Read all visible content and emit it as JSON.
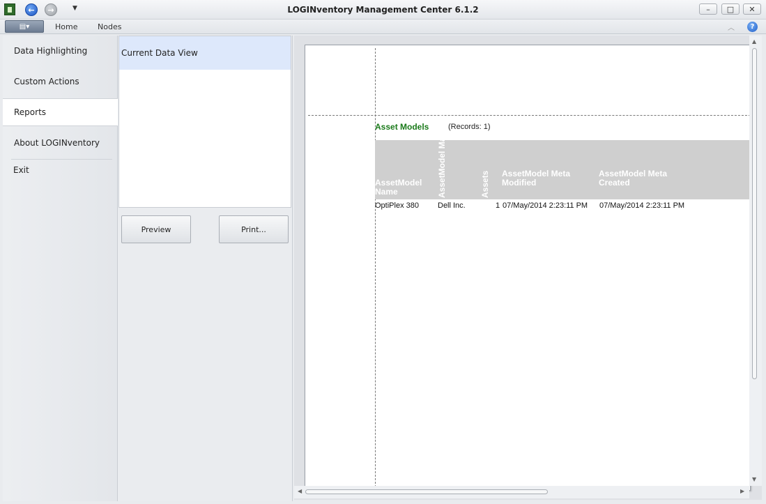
{
  "window": {
    "title": "LOGINventory Management Center 6.1.2",
    "minimize_glyph": "–",
    "maximize_glyph": "□",
    "close_glyph": "✕"
  },
  "quick_access": {
    "back_glyph": "←",
    "forward_glyph": "→",
    "dropdown_glyph": "▼"
  },
  "ribbon": {
    "app_menu_glyph": "▤▾",
    "tabs": [
      "Home",
      "Nodes"
    ],
    "collapse_glyph": "︿",
    "help_glyph": "?"
  },
  "nav": {
    "items": [
      "Data Highlighting",
      "Custom Actions",
      "Reports",
      "About LOGINventory"
    ],
    "active": "Reports",
    "exit_label": "Exit"
  },
  "reports": {
    "items": [
      "Current Data View"
    ],
    "preview_button": "Preview",
    "print_button": "Print..."
  },
  "report": {
    "title": "Asset Models",
    "records": "(Records: 1)",
    "columns": {
      "name": "AssetModel Name",
      "manufacturer": "AssetModel Manufacturer",
      "assets": "Assets",
      "modified": "AssetModel Meta Modified",
      "created": "AssetModel Meta Created"
    },
    "rows": [
      {
        "name": "OptiPlex 380",
        "manufacturer": "Dell Inc.",
        "assets": "1",
        "modified": "07/May/2014 2:23:11 PM",
        "created": "07/May/2014 2:23:11 PM"
      }
    ]
  },
  "scroll": {
    "up_glyph": "▲",
    "down_glyph": "▼",
    "left_glyph": "◀",
    "right_glyph": "▶"
  },
  "colors": {
    "report_title": "#1a7a1a",
    "header_bg": "#cfcfcf",
    "selected_report": "#dde8fb"
  }
}
